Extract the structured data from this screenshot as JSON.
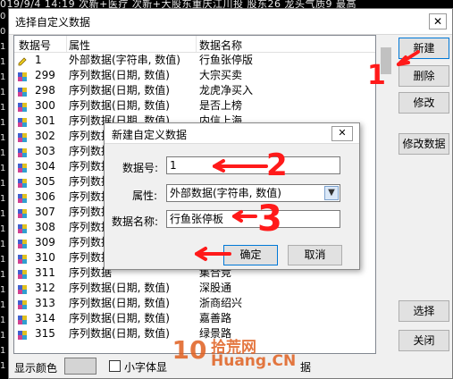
{
  "ticker": "019/9/4 14:19  次新+医疗  次新+大股东重庆江川投  股东26 龙头气质9 最高",
  "left_strip": [
    "0",
    "0",
    "1",
    "1",
    "1",
    "1",
    "1",
    "1",
    "1",
    "1",
    "1",
    "1",
    "1",
    "1",
    "1",
    "1",
    "1",
    "1",
    "1",
    "1",
    "1",
    "1",
    "1",
    "1"
  ],
  "window": {
    "title": "选择自定义数据",
    "close_glyph": "✕"
  },
  "list": {
    "columns": [
      "数据号",
      "属性",
      "数据名称"
    ],
    "rows": [
      {
        "id": "1",
        "attr": "外部数据(字符串, 数值)",
        "name": "行鱼张停版",
        "icon": "pencil-icon"
      },
      {
        "id": "299",
        "attr": "序列数据(日期, 数值)",
        "name": "大宗买卖",
        "icon": "series-icon"
      },
      {
        "id": "298",
        "attr": "序列数据(日期, 数值)",
        "name": "龙虎净买入",
        "icon": "series-icon"
      },
      {
        "id": "300",
        "attr": "序列数据(日期, 数值)",
        "name": "是否上榜",
        "icon": "series-icon"
      },
      {
        "id": "301",
        "attr": "序列数据(日期, 数值)",
        "name": "内信上海",
        "icon": "series-icon"
      },
      {
        "id": "302",
        "attr": "序列数据",
        "name": "",
        "icon": "series-icon"
      },
      {
        "id": "303",
        "attr": "序列数据",
        "name": "",
        "icon": "series-icon"
      },
      {
        "id": "304",
        "attr": "序列数据",
        "name": "",
        "icon": "series-icon"
      },
      {
        "id": "305",
        "attr": "序列数据",
        "name": "",
        "icon": "series-icon"
      },
      {
        "id": "306",
        "attr": "序列数据",
        "name": "",
        "icon": "series-icon"
      },
      {
        "id": "307",
        "attr": "序列数据",
        "name": "",
        "icon": "series-icon"
      },
      {
        "id": "308",
        "attr": "序列数据",
        "name": "",
        "icon": "series-icon"
      },
      {
        "id": "309",
        "attr": "序列数据",
        "name": "",
        "icon": "series-icon"
      },
      {
        "id": "310",
        "attr": "序列数据",
        "name": "",
        "icon": "series-icon"
      },
      {
        "id": "311",
        "attr": "序列数据",
        "name": "集合竞",
        "icon": "series-icon"
      },
      {
        "id": "312",
        "attr": "序列数据(日期, 数值)",
        "name": "深股通",
        "icon": "series-icon"
      },
      {
        "id": "313",
        "attr": "序列数据(日期, 数值)",
        "name": "浙商绍兴",
        "icon": "series-icon"
      },
      {
        "id": "314",
        "attr": "序列数据(日期, 数值)",
        "name": "嘉善路",
        "icon": "series-icon"
      },
      {
        "id": "315",
        "attr": "序列数据(日期, 数值)",
        "name": "绿景路",
        "icon": "series-icon"
      }
    ]
  },
  "buttons": {
    "new": "新建",
    "delete": "删除",
    "modify": "修改",
    "modify_data": "修改数据",
    "select": "选择",
    "close": "关闭"
  },
  "bottom": {
    "display_color_label": "显示颜色",
    "small_font_label": "小字体显",
    "trailing_text": "据"
  },
  "dialog": {
    "title": "新建自定义数据",
    "close_glyph": "✕",
    "id_label": "数据号:",
    "id_value": "1",
    "attr_label": "属性:",
    "attr_value": "外部数据(字符串, 数值)",
    "name_label": "数据名称:",
    "name_value": "行鱼张停板",
    "ok": "确定",
    "cancel": "取消"
  },
  "annotations": [
    "1",
    "2",
    "3"
  ],
  "watermark": {
    "logo_text": "10",
    "brand_cn": "拾荒网",
    "brand_en": "Huang.CN"
  },
  "colors": {
    "annotation_red": "#ff1a1a",
    "swatch_gray": "#d4d4d4",
    "primary_border": "#0078d7",
    "watermark_orange": "#e06020"
  }
}
